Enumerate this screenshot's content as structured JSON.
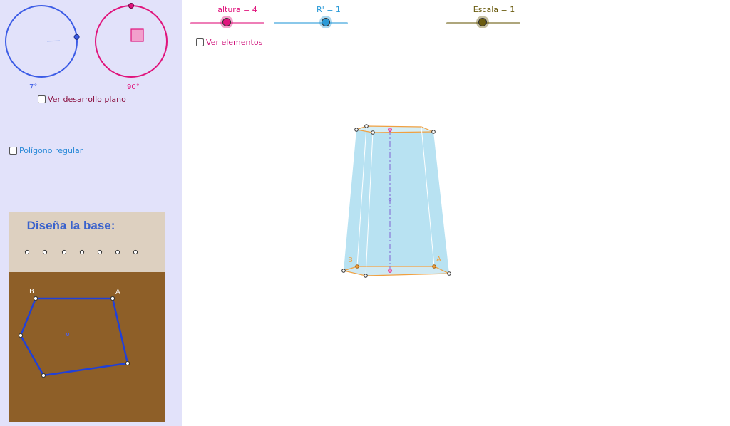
{
  "colors": {
    "blue": "#3c5ce6",
    "magenta": "#e0147c",
    "sky": "#2a9ad8",
    "olive": "#6b5c10",
    "panel_bg": "#e2e2fa",
    "base_header_bg": "#ddd0c0",
    "base_canvas_bg": "#8e5f28",
    "prism_fill": "#b8e2f2",
    "prism_edge": "#f0a040"
  },
  "left_panel": {
    "dial_rotation_label": "7°",
    "dial_rotation_deg": 7,
    "dial_tilt_label": "90°",
    "dial_tilt_deg": 90,
    "flat_development_checkbox": {
      "label": "Ver desarrollo plano",
      "checked": false
    },
    "regular_polygon_checkbox": {
      "label": "Polígono regular",
      "checked": false
    },
    "base_designer": {
      "title": "Diseña la base:",
      "point_labels": [
        "B",
        "A"
      ]
    }
  },
  "main": {
    "sliders": [
      {
        "name": "altura",
        "label": "altura = 4",
        "color": "#e0147c",
        "fraction": 0.5
      },
      {
        "name": "radio",
        "label": "R' = 1",
        "color": "#2a9ad8",
        "fraction": 0.71
      },
      {
        "name": "escala",
        "label": "Escala = 1",
        "color": "#6b5c10",
        "fraction": 0.5
      }
    ],
    "elements_checkbox": {
      "label": "Ver elementos",
      "checked": false
    },
    "prism_vertex_labels": [
      "B",
      "A"
    ]
  }
}
